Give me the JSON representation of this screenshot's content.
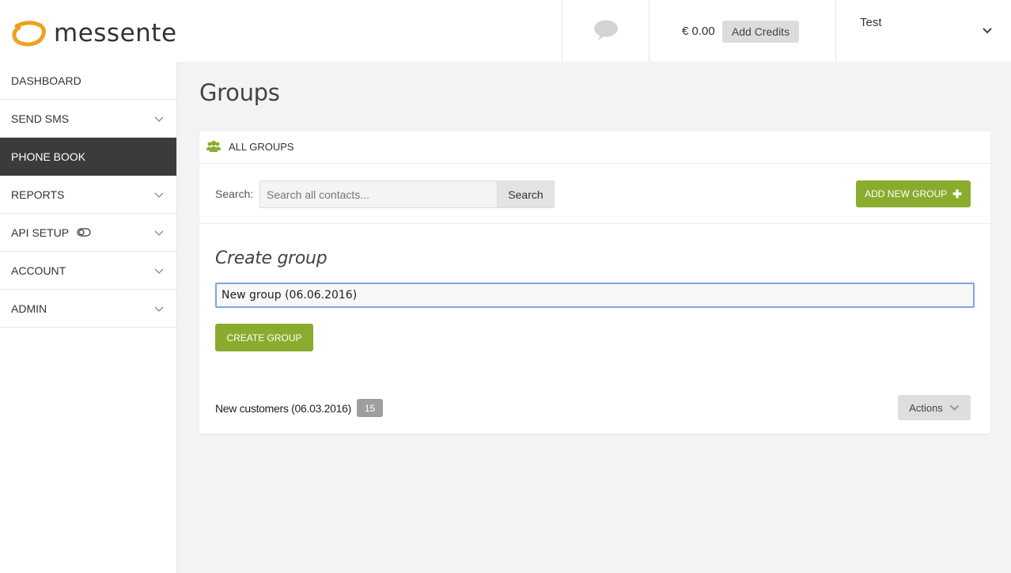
{
  "header": {
    "brand": "messente",
    "balance": "€ 0.00",
    "add_credits_label": "Add Credits",
    "user_name": "Test"
  },
  "sidebar": {
    "items": [
      {
        "label": "DASHBOARD",
        "has_chevron": false,
        "active": false
      },
      {
        "label": "SEND SMS",
        "has_chevron": true,
        "active": false
      },
      {
        "label": "PHONE BOOK",
        "has_chevron": false,
        "active": true
      },
      {
        "label": "REPORTS",
        "has_chevron": true,
        "active": false
      },
      {
        "label": "API SETUP",
        "has_chevron": true,
        "active": false
      },
      {
        "label": "ACCOUNT",
        "has_chevron": true,
        "active": false
      },
      {
        "label": "ADMIN",
        "has_chevron": true,
        "active": false
      }
    ]
  },
  "main": {
    "page_title": "Groups",
    "card_title": "ALL GROUPS",
    "search_label": "Search:",
    "search_placeholder": "Search all contacts...",
    "search_button": "Search",
    "add_group_button": "ADD NEW GROUP",
    "create_title": "Create group",
    "group_input_value": "New group (06.06.2016)",
    "create_button": "CREATE GROUP",
    "groups": [
      {
        "name": "New customers (06.03.2016)",
        "count": "15"
      }
    ],
    "actions_label": "Actions"
  },
  "colors": {
    "brand_orange": "#f0a020",
    "accent_green": "#8aac2e",
    "sidebar_active": "#3a3b3d",
    "focus_blue": "#7aa7e0"
  }
}
